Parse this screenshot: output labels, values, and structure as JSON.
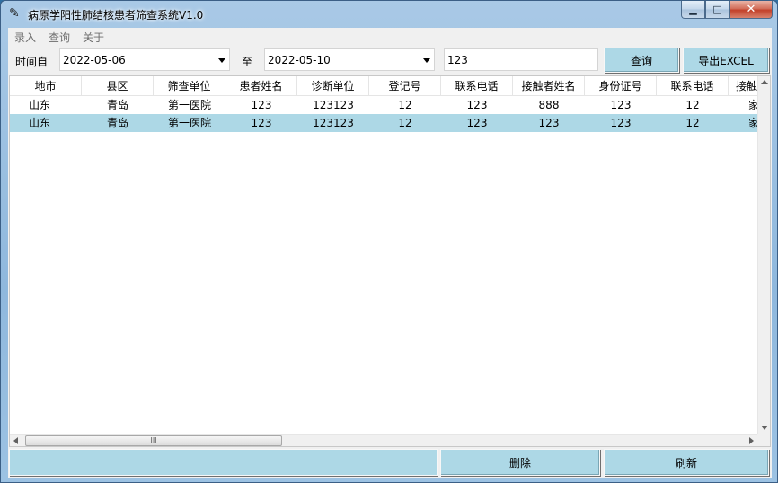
{
  "window": {
    "title": "病原学阳性肺结核患者筛查系统V1.0",
    "app_icon": "feather-icon",
    "controls": {
      "minimize": "▁",
      "maximize": "□",
      "close": "✕"
    }
  },
  "menu": {
    "items": [
      "录入",
      "查询",
      "关于"
    ]
  },
  "toolbar": {
    "from_label": "时间自",
    "from_date": "2022-05-06",
    "to_label": "至",
    "to_date": "2022-05-10",
    "search_value": "123",
    "query_label": "查询",
    "export_label": "导出EXCEL"
  },
  "table": {
    "columns": [
      "地市",
      "县区",
      "筛查单位",
      "患者姓名",
      "诊断单位",
      "登记号",
      "联系电话",
      "接触者姓名",
      "身份证号",
      "联系电话",
      "接触"
    ],
    "rows": [
      {
        "cells": [
          "山东",
          "青岛",
          "第一医院",
          "123",
          "123123",
          "12",
          "123",
          "888",
          "123",
          "12",
          "家"
        ],
        "selected": false
      },
      {
        "cells": [
          "山东",
          "青岛",
          "第一医院",
          "123",
          "123123",
          "12",
          "123",
          "123",
          "123",
          "12",
          "家"
        ],
        "selected": true
      }
    ],
    "scroll_thumb_label": "III"
  },
  "footer": {
    "delete_label": "删除",
    "refresh_label": "刷新"
  },
  "colors": {
    "button_bg": "#add8e6",
    "selected_row": "#add8e6"
  }
}
